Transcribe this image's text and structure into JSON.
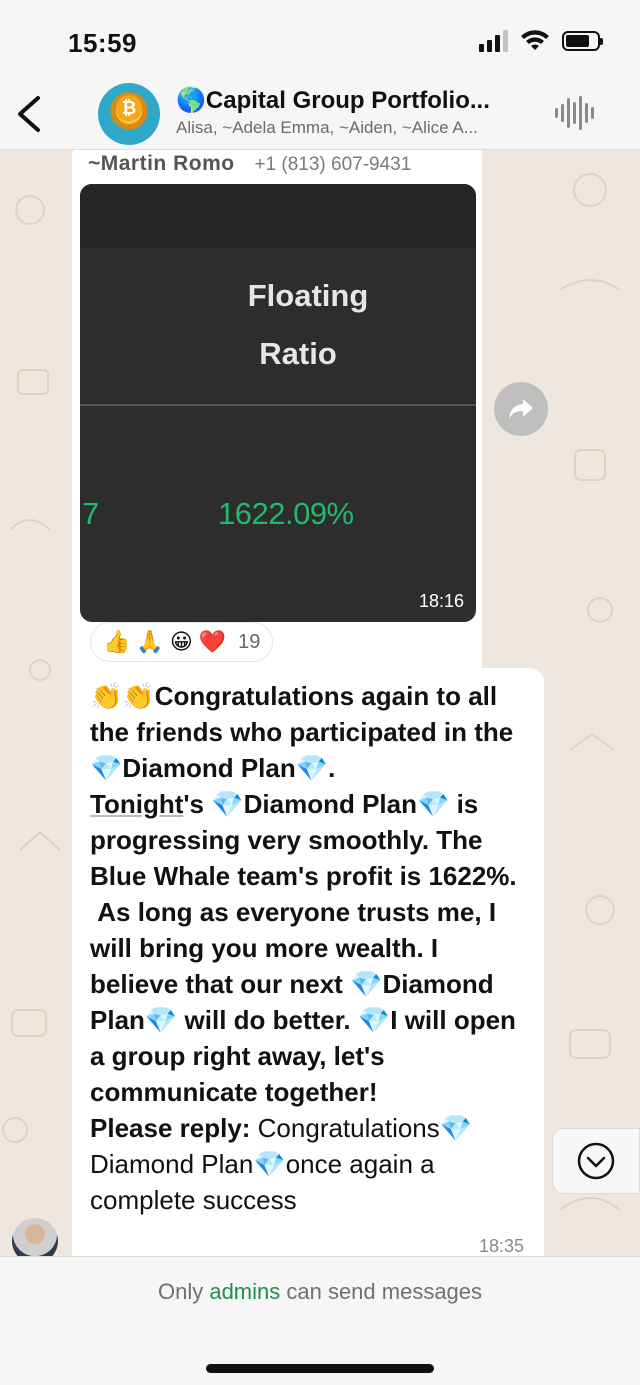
{
  "status_bar": {
    "time": "15:59",
    "battery_level_percent": 75
  },
  "header": {
    "title": "🌎Capital Group Portfolio...",
    "subtitle": "Alisa, ~Adela Emma, ~Aiden, ~Alice A...",
    "avatar_icon": "bitcoin-group-avatar"
  },
  "messages": {
    "image_message": {
      "sender_name": "~Martin  Romo",
      "sender_phone": "+1 (813) 607-9431",
      "media": {
        "heading_line1": "Floating",
        "heading_line2": "Ratio",
        "left_digit": "7",
        "value": "1622.09%"
      },
      "time": "18:16",
      "reactions": {
        "emojis": [
          "👍",
          "🙏",
          "😀",
          "❤️"
        ],
        "count": "19"
      }
    },
    "text_message": {
      "l1a": "👏👏Congratulations again to all the friends who participated in the ",
      "gem": "💎",
      "l1b": "Diamond Plan",
      "l1c": ".",
      "l2a": "Tonight",
      "l2b": "'s ",
      "l2c": "Diamond Plan",
      "l2d": " is progressing very smoothly. The Blue Whale team's profit is 1622%.",
      "l3": "As long as everyone trusts me, I will bring you more wealth. I believe that our next ",
      "l3b": "Diamond Plan",
      "l3c": " will do better. ",
      "l3d": "I will open a group right away, let's communicate together!",
      "l4a": "Please reply: ",
      "l4b": "Congratulations",
      "l4c": "Diamond Plan",
      "l4d": "once again a complete success",
      "time": "18:35"
    }
  },
  "footer": {
    "text_before": "Only ",
    "admins": "admins",
    "text_after": " can send messages"
  },
  "colors": {
    "accent_green": "#1f8d4b",
    "chart_green": "#1fba6b",
    "chat_bg": "#efe7dd"
  }
}
